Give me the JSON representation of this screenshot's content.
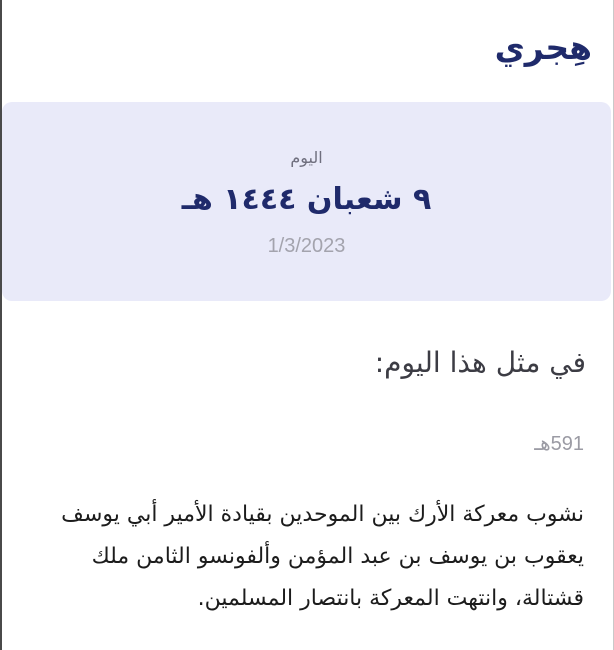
{
  "app": {
    "title": "هِجري"
  },
  "today": {
    "label": "اليوم",
    "hijri_date": "٩ شعبان ١٤٤٤ هـ",
    "gregorian_date": "1/3/2023"
  },
  "on_this_day": {
    "heading": "في مثل هذا اليوم:",
    "events": [
      {
        "year": "591هـ",
        "text": "نشوب معركة الأرك بين الموحدين بقيادة الأمير أبي يوسف يعقوب بن يوسف بن عبد المؤمن وألفونسو الثامن ملك قشتالة، وانتهت المعركة بانتصار المسلمين."
      }
    ]
  }
}
